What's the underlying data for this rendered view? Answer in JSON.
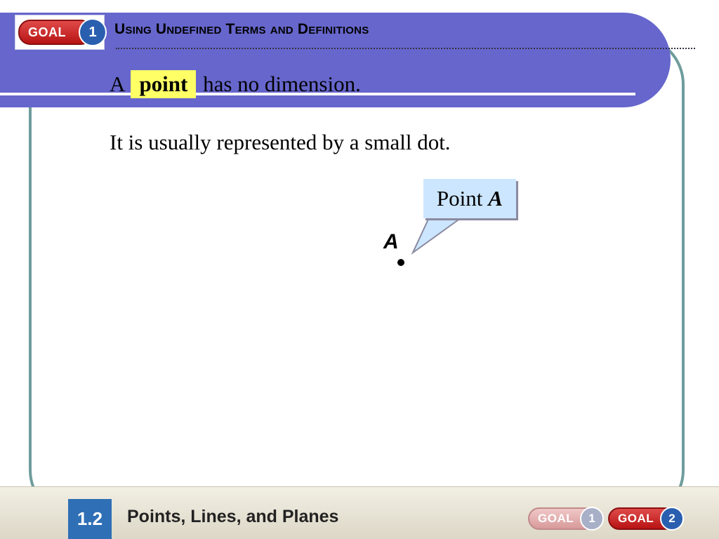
{
  "header": {
    "goal_badge": {
      "word": "GOAL",
      "number": "1"
    },
    "title": "Using Undefined Terms and Definitions"
  },
  "content": {
    "line1": {
      "before": "A",
      "term": "point",
      "after": "has no dimension."
    },
    "line2": "It is usually represented by a small dot.",
    "callout": {
      "text": "Point",
      "var": "A"
    },
    "point_label": "A"
  },
  "footer": {
    "section": "1.2",
    "title": "Points, Lines, and Planes",
    "goals": [
      {
        "word": "GOAL",
        "number": "1",
        "active": false
      },
      {
        "word": "GOAL",
        "number": "2",
        "active": true
      }
    ]
  },
  "colors": {
    "banner": "#6666cc",
    "frame": "#6f9c9c",
    "highlight": "#ffff66",
    "callout_fill": "#cce6ff",
    "goal_red": "#c81e1e",
    "goal_blue": "#2a5fb0"
  }
}
